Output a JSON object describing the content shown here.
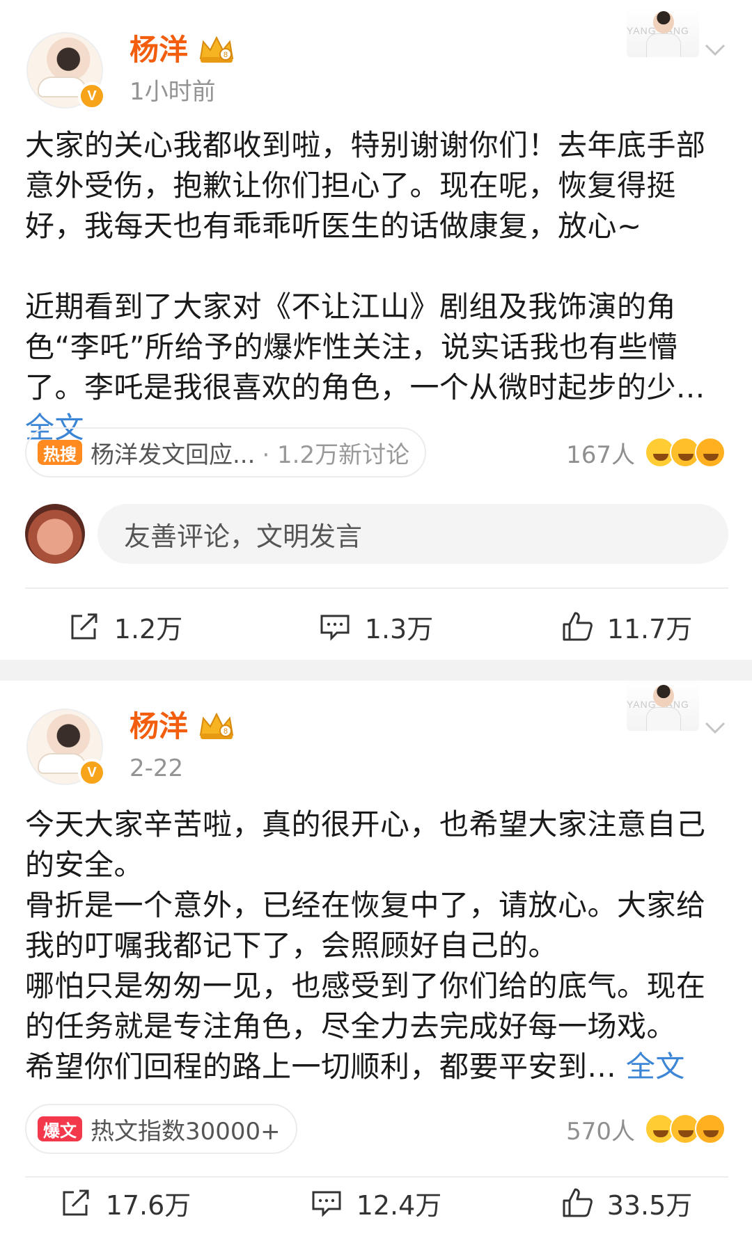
{
  "posts": [
    {
      "author": "杨洋",
      "time": "1小时前",
      "thumb_text": "YANG YANG",
      "content": [
        "大家的关心我都收到啦，特别谢谢你们！去年底手部意外受伤，抱歉让你们担心了。现在呢，恢复得挺好，我每天也有乖乖听医生的话做康复，放心~",
        "",
        "近期看到了大家对《不让江山》剧组及我饰演的角色“李吒”所给予的爆炸性关注，说实话我也有些懵了。李吒是我很喜欢的角色，一个从微时起步的少..."
      ],
      "full_text_label": "全文",
      "hot": {
        "badge": "热搜",
        "text": "杨洋发文回应...",
        "sub": "· 1.2万新讨论"
      },
      "reaction_count": "167人",
      "comment_placeholder": "友善评论，文明发言",
      "actions": {
        "repost": "1.2万",
        "comment": "1.3万",
        "like": "11.7万"
      }
    },
    {
      "author": "杨洋",
      "time": "2-22",
      "thumb_text": "YANG YANG",
      "content": [
        "今天大家辛苦啦，真的很开心，也希望大家注意自己的安全。",
        "骨折是一个意外，已经在恢复中了，请放心。大家给我的叮嘱我都记下了，会照顾好自己的。",
        "哪怕只是匆匆一见，也感受到了你们给的底气。现在的任务就是专注角色，尽全力去完成好每一场戏。",
        "希望你们回程的路上一切顺利，都要平安到..."
      ],
      "full_text_label": "全文",
      "hot": {
        "badge": "爆文",
        "text": "热文指数30000+"
      },
      "reaction_count": "570人",
      "actions": {
        "repost": "17.6万",
        "comment": "12.4万",
        "like": "33.5万"
      }
    }
  ],
  "icons": [
    "verified-v-icon",
    "crown-icon",
    "chevron-down-icon",
    "repost-icon",
    "comment-icon",
    "like-icon",
    "emoji-icon"
  ],
  "colors": {
    "name": "#f25d0e",
    "link": "#3d86d6",
    "hot_search": "#ff8a1f",
    "hot_article": "#f2384a"
  }
}
